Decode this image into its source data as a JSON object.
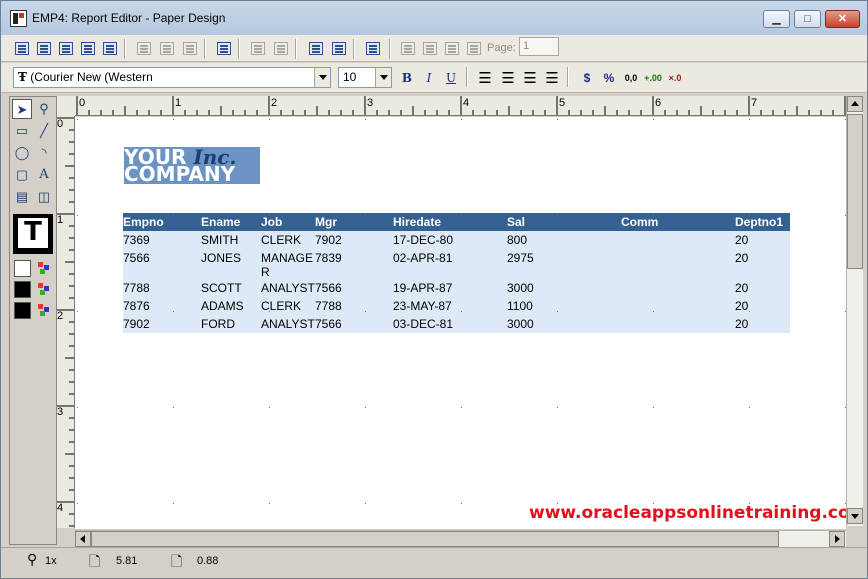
{
  "window": {
    "title": "EMP4: Report Editor - Paper Design",
    "controls": {
      "minimize": "▁",
      "maximize": "□",
      "close": "✕"
    }
  },
  "toolbar": {
    "page_label": "Page:",
    "page_value": "1"
  },
  "format_bar": {
    "font": "(Courier New (Western",
    "size": "10",
    "bold": "B",
    "italic": "I",
    "underline": "U",
    "currency": "$",
    "percent": "%",
    "commas": "0,0",
    "add_decimal": "+.00",
    "remove_decimal": "×.0"
  },
  "palette": {
    "text_tool_glyph": "A",
    "big_tool_glyph": "T"
  },
  "rulers": {
    "horizontal": [
      "0",
      "1",
      "2",
      "3",
      "4",
      "5",
      "6",
      "7"
    ],
    "vertical": [
      "0",
      "1",
      "2",
      "3",
      "4"
    ]
  },
  "logo": {
    "line1_your": "YOUR",
    "line1_inc": "Inc.",
    "line2": "COMPANY"
  },
  "report": {
    "columns": [
      "Empno",
      "Ename",
      "Job",
      "Mgr",
      "Hiredate",
      "Sal",
      "Comm",
      "Deptno1"
    ],
    "rows": [
      [
        "7369",
        "SMITH",
        "CLERK",
        "7902",
        "17-DEC-80",
        "800",
        "",
        "20"
      ],
      [
        "7566",
        "JONES",
        "MANAGE\nR",
        "7839",
        "02-APR-81",
        "2975",
        "",
        "20"
      ],
      [
        "7788",
        "SCOTT",
        "ANALYST",
        "7566",
        "19-APR-87",
        "3000",
        "",
        "20"
      ],
      [
        "7876",
        "ADAMS",
        "CLERK",
        "7788",
        "23-MAY-87",
        "1100",
        "",
        "20"
      ],
      [
        "7902",
        "FORD",
        "ANALYST",
        "7566",
        "03-DEC-81",
        "3000",
        "",
        "20"
      ]
    ]
  },
  "watermark": "www.oracleappsonlinetraining.com",
  "statusbar": {
    "zoom": "1x",
    "x": "5.81",
    "y": "0.88"
  },
  "colors": {
    "header_bg": "#34618f",
    "body_bg": "#dde9f7",
    "logo_bg": "#6b93c4",
    "watermark": "#e0101c"
  }
}
